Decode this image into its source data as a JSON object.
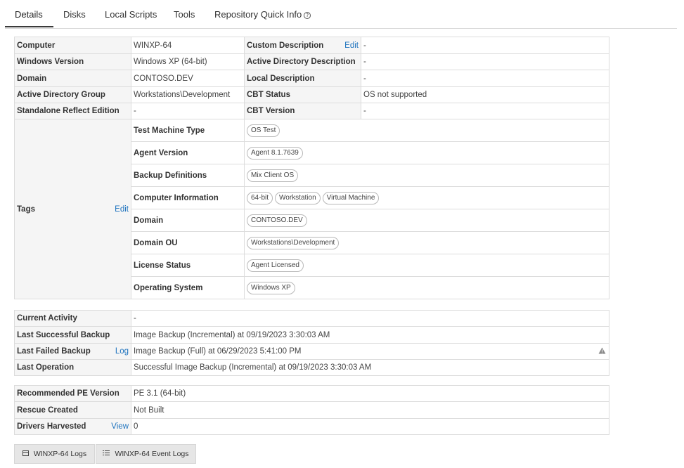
{
  "tabs": [
    {
      "label": "Details"
    },
    {
      "label": "Disks"
    },
    {
      "label": "Local Scripts"
    },
    {
      "label": "Tools"
    },
    {
      "label": "Repository Quick Info"
    }
  ],
  "details": {
    "computer_label": "Computer",
    "computer_value": "WINXP-64",
    "custom_desc_label": "Custom Description",
    "edit_label": "Edit",
    "custom_desc_value": "-",
    "windows_version_label": "Windows Version",
    "windows_version_value": "Windows XP (64-bit)",
    "ad_desc_label": "Active Directory Description",
    "ad_desc_value": "-",
    "domain_label": "Domain",
    "domain_value": "CONTOSO.DEV",
    "local_desc_label": "Local Description",
    "local_desc_value": "-",
    "ad_group_label": "Active Directory Group",
    "ad_group_value": "Workstations\\Development",
    "cbt_status_label": "CBT Status",
    "cbt_status_value": "OS not supported",
    "standalone_label": "Standalone Reflect Edition",
    "standalone_value": "-",
    "cbt_version_label": "CBT Version",
    "cbt_version_value": "-"
  },
  "tags": {
    "label": "Tags",
    "edit_label": "Edit",
    "rows": [
      {
        "name": "Test Machine Type",
        "values": [
          "OS Test"
        ]
      },
      {
        "name": "Agent Version",
        "values": [
          "Agent 8.1.7639"
        ]
      },
      {
        "name": "Backup Definitions",
        "values": [
          "Mix Client OS"
        ]
      },
      {
        "name": "Computer Information",
        "values": [
          "64-bit",
          "Workstation",
          "Virtual Machine"
        ]
      },
      {
        "name": "Domain",
        "values": [
          "CONTOSO.DEV"
        ]
      },
      {
        "name": "Domain OU",
        "values": [
          "Workstations\\Development"
        ]
      },
      {
        "name": "License Status",
        "values": [
          "Agent Licensed"
        ]
      },
      {
        "name": "Operating System",
        "values": [
          "Windows XP"
        ]
      }
    ]
  },
  "activity": {
    "current_label": "Current Activity",
    "current_value": "-",
    "last_success_label": "Last Successful Backup",
    "last_success_value": "Image Backup (Incremental) at 09/19/2023 3:30:03 AM",
    "last_failed_label": "Last Failed Backup",
    "log_label": "Log",
    "last_failed_value": "Image Backup (Full) at 06/29/2023 5:41:00 PM",
    "last_op_label": "Last Operation",
    "last_op_value": "Successful Image Backup (Incremental) at 09/19/2023 3:30:03 AM"
  },
  "rescue": {
    "pe_label": "Recommended PE Version",
    "pe_value": "PE 3.1 (64-bit)",
    "rescue_label": "Rescue Created",
    "rescue_value": "Not Built",
    "drivers_label": "Drivers Harvested",
    "view_label": "View",
    "drivers_value": "0"
  },
  "buttons": {
    "logs_label": "WINXP-64 Logs",
    "event_logs_label": "WINXP-64 Event Logs"
  },
  "icons": {
    "repo_info": "info-circle-icon",
    "warning": "warning-triangle-icon",
    "logs": "calendar-icon",
    "event_logs": "list-icon"
  },
  "colors": {
    "link": "#1e73be",
    "label_bg": "#f5f5f5",
    "border": "#dcdcdc",
    "button_bg": "#e6e6e6"
  }
}
